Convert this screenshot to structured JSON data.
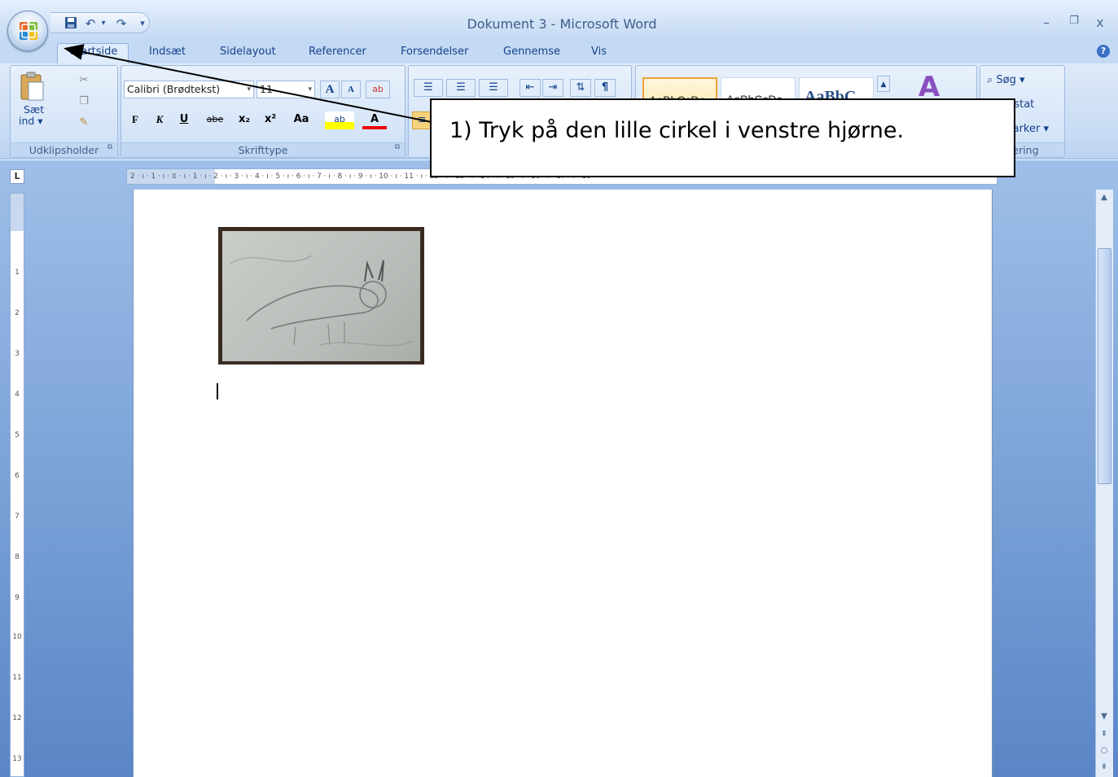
{
  "window": {
    "title": "Dokument 3 - Microsoft Word",
    "minimize": "–",
    "restore": "❐",
    "close": "x"
  },
  "quick_access": {
    "save_icon": "floppy-disk-icon",
    "undo": "↶",
    "redo": "↷",
    "customize": "▾"
  },
  "tabs": [
    {
      "label": "Startside",
      "active": true
    },
    {
      "label": "Indsæt"
    },
    {
      "label": "Sidelayout"
    },
    {
      "label": "Referencer"
    },
    {
      "label": "Forsendelser"
    },
    {
      "label": "Gennemse"
    },
    {
      "label": "Vis"
    }
  ],
  "help": "?",
  "clipboard": {
    "label": "Udklipsholder",
    "paste_label_1": "Sæt",
    "paste_label_2": "ind ▾"
  },
  "font": {
    "label": "Skrifttype",
    "family": "Calibri (Brødtekst)",
    "size": "11",
    "bold": "F",
    "italic": "K",
    "underline": "U",
    "strikethrough": "abe",
    "subscript": "x₂",
    "superscript": "x²",
    "change_case": "Aa",
    "grow": "A",
    "shrink": "A",
    "font_color": "A"
  },
  "styles": {
    "items": [
      "AaBbCcDc",
      "AaBbCcDc",
      "AaBbC"
    ]
  },
  "editing": {
    "find": "Søg ▾",
    "replace_partial": "rstat",
    "select_partial": "larker ▾",
    "label_partial": "gering"
  },
  "ruler": {
    "tab_selector": "L",
    "h_marks": "2 · ı · 1 · ı · ⧖ · ı · 1 · ı · 2 · ı · 3 · ı · 4 · ı · 5 · ı · 6 · ı · 7 · ı · 8 · ı · 9 · ı · 10 · ı · 11 · ı · 12 · ı · 13 · ı · 14 · ı · 15 · ı · 16 · ı · 17 · ı · 18",
    "v_marks": [
      "1",
      "2",
      "3",
      "4",
      "5",
      "6",
      "7",
      "8",
      "9",
      "10",
      "11",
      "12",
      "13"
    ]
  },
  "callout": {
    "text": "1) Tryk på den lille cirkel i venstre hjørne."
  },
  "colors": {
    "ribbon": "#dde9f7",
    "accent": "#15428b",
    "background": "#5a86c7"
  }
}
